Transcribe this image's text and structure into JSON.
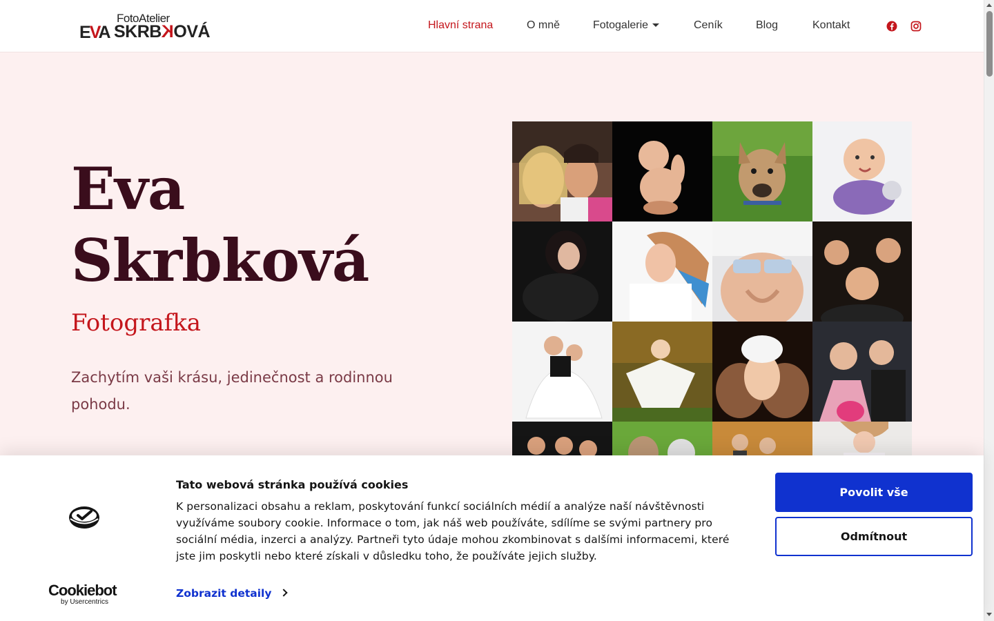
{
  "header": {
    "logo": {
      "small": "FotoAtelier",
      "eva_e": "E",
      "eva_v": "V",
      "eva_a": "A",
      "name_main": "SKRB",
      "name_k": "K",
      "name_end": "OVÁ"
    },
    "nav": [
      {
        "label": "Hlavní strana",
        "active": true
      },
      {
        "label": "O mně"
      },
      {
        "label": "Fotogalerie",
        "has_dropdown": true
      },
      {
        "label": "Ceník"
      },
      {
        "label": "Blog"
      },
      {
        "label": "Kontakt"
      }
    ],
    "social": [
      "facebook-icon",
      "instagram-icon"
    ],
    "accent_color": "#c4161c"
  },
  "hero": {
    "title_line1": "Eva",
    "title_line2": "Skrbková",
    "subtitle": "Fotografka",
    "text": "Zachytím vaši krásu, jedinečnost a rodinnou pohodu."
  },
  "gallery": {
    "tiles": [
      "photo-couple",
      "photo-baby-black",
      "photo-dog",
      "photo-baby-white",
      "photo-woman-black",
      "photo-girl-blue-hair",
      "photo-pregnancy",
      "photo-family",
      "photo-mother-daughters",
      "photo-woman-autumn",
      "photo-baby-feet",
      "photo-wedding",
      "photo-group",
      "photo-dog-grass",
      "photo-autumn-group",
      "photo-woman-light"
    ]
  },
  "cookie": {
    "title": "Tato webová stránka používá cookies",
    "body": "K personalizaci obsahu a reklam, poskytování funkcí sociálních médií a analýze naší návštěvnosti využíváme soubory cookie. Informace o tom, jak náš web používáte, sdílíme se svými partnery pro sociální média, inzerci a analýzy. Partneři tyto údaje mohou zkombinovat s dalšími informacemi, které jste jim poskytli nebo které získali v důsledku toho, že používáte jejich služby.",
    "details_label": "Zobrazit detaily",
    "allow_label": "Povolit vše",
    "deny_label": "Odmítnout",
    "brand_big": "Cookiebot",
    "brand_small": "by Usercentrics",
    "button_color": "#1032cf"
  }
}
